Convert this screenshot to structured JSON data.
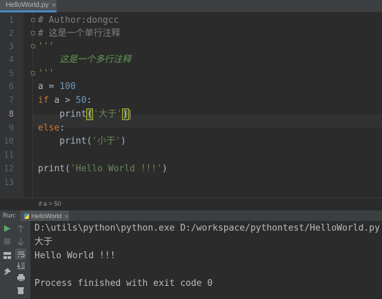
{
  "tab": {
    "title": "HelloWorld.py",
    "close": "×",
    "icon": "python-file-icon"
  },
  "gutter": {
    "line_numbers": [
      "1",
      "2",
      "3",
      "4",
      "5",
      "6",
      "7",
      "8",
      "9",
      "10",
      "11",
      "12",
      "13"
    ],
    "active_line": "8"
  },
  "code": {
    "l1": "# Author:dongcc",
    "l2": "# 这是一个单行注释",
    "l3": "'''",
    "l4": "    这是一个多行注释",
    "l5": "'''",
    "l6_var": "a",
    "l6_eq": " = ",
    "l6_num": "100",
    "l7_kw": "if",
    "l7_mid": " a > ",
    "l7_num": "50",
    "l7_colon": ":",
    "l8_fn": "    print",
    "l8_open": "(",
    "l8_str": "'大于'",
    "l8_close": ")",
    "l9_kw": "else",
    "l9_colon": ":",
    "l10_fn": "    print(",
    "l10_str": "'小于'",
    "l10_close": ")",
    "l12_fn": "print(",
    "l12_str": "'Hello World !!!'",
    "l12_close": ")"
  },
  "breadcrumb": "if a > 50",
  "run": {
    "label": "Run:",
    "tab_title": "HelloWorld",
    "tab_close": "×",
    "output": [
      "D:\\utils\\python\\python.exe D:/workspace/pythontest/HelloWorld.py",
      "大于",
      "Hello World !!!",
      "",
      "Process finished with exit code 0"
    ]
  },
  "colors": {
    "accent": "#4a88c7",
    "run_green": "#59a869",
    "stop_red": "#c75450"
  }
}
